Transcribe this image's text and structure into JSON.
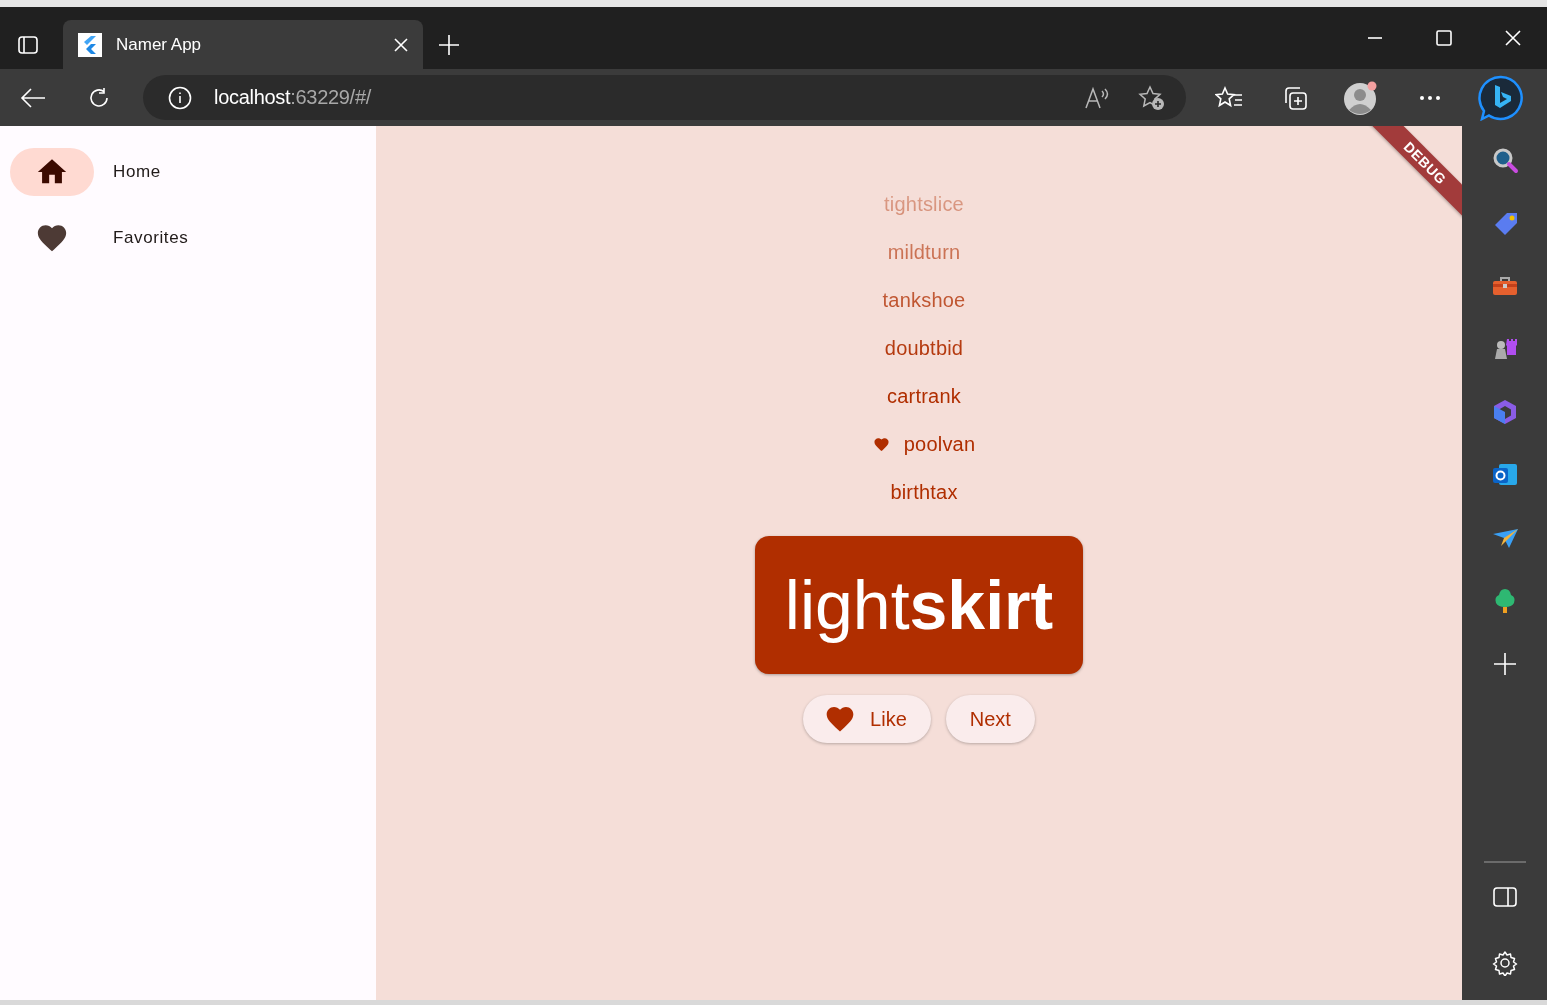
{
  "browser": {
    "tab": {
      "title": "Namer App"
    },
    "address": {
      "host": "localhost",
      "rest": ":63229/#/"
    }
  },
  "navigation": [
    {
      "label": "Home",
      "selected": true
    },
    {
      "label": "Favorites",
      "selected": false
    }
  ],
  "debug_banner": "DEBUG",
  "history": [
    {
      "text": "tightslice",
      "favorite": false
    },
    {
      "text": "mildturn",
      "favorite": false
    },
    {
      "text": "tankshoe",
      "favorite": false
    },
    {
      "text": "doubtbid",
      "favorite": false
    },
    {
      "text": "cartrank",
      "favorite": false
    },
    {
      "text": "poolvan",
      "favorite": true
    },
    {
      "text": "birthtax",
      "favorite": false
    }
  ],
  "current": {
    "text": "light**skirt**",
    "favorite": true
  },
  "buttons": [
    {
      "kind": "like",
      "label": "Like"
    },
    {
      "kind": "next",
      "label": "Next"
    }
  ]
}
